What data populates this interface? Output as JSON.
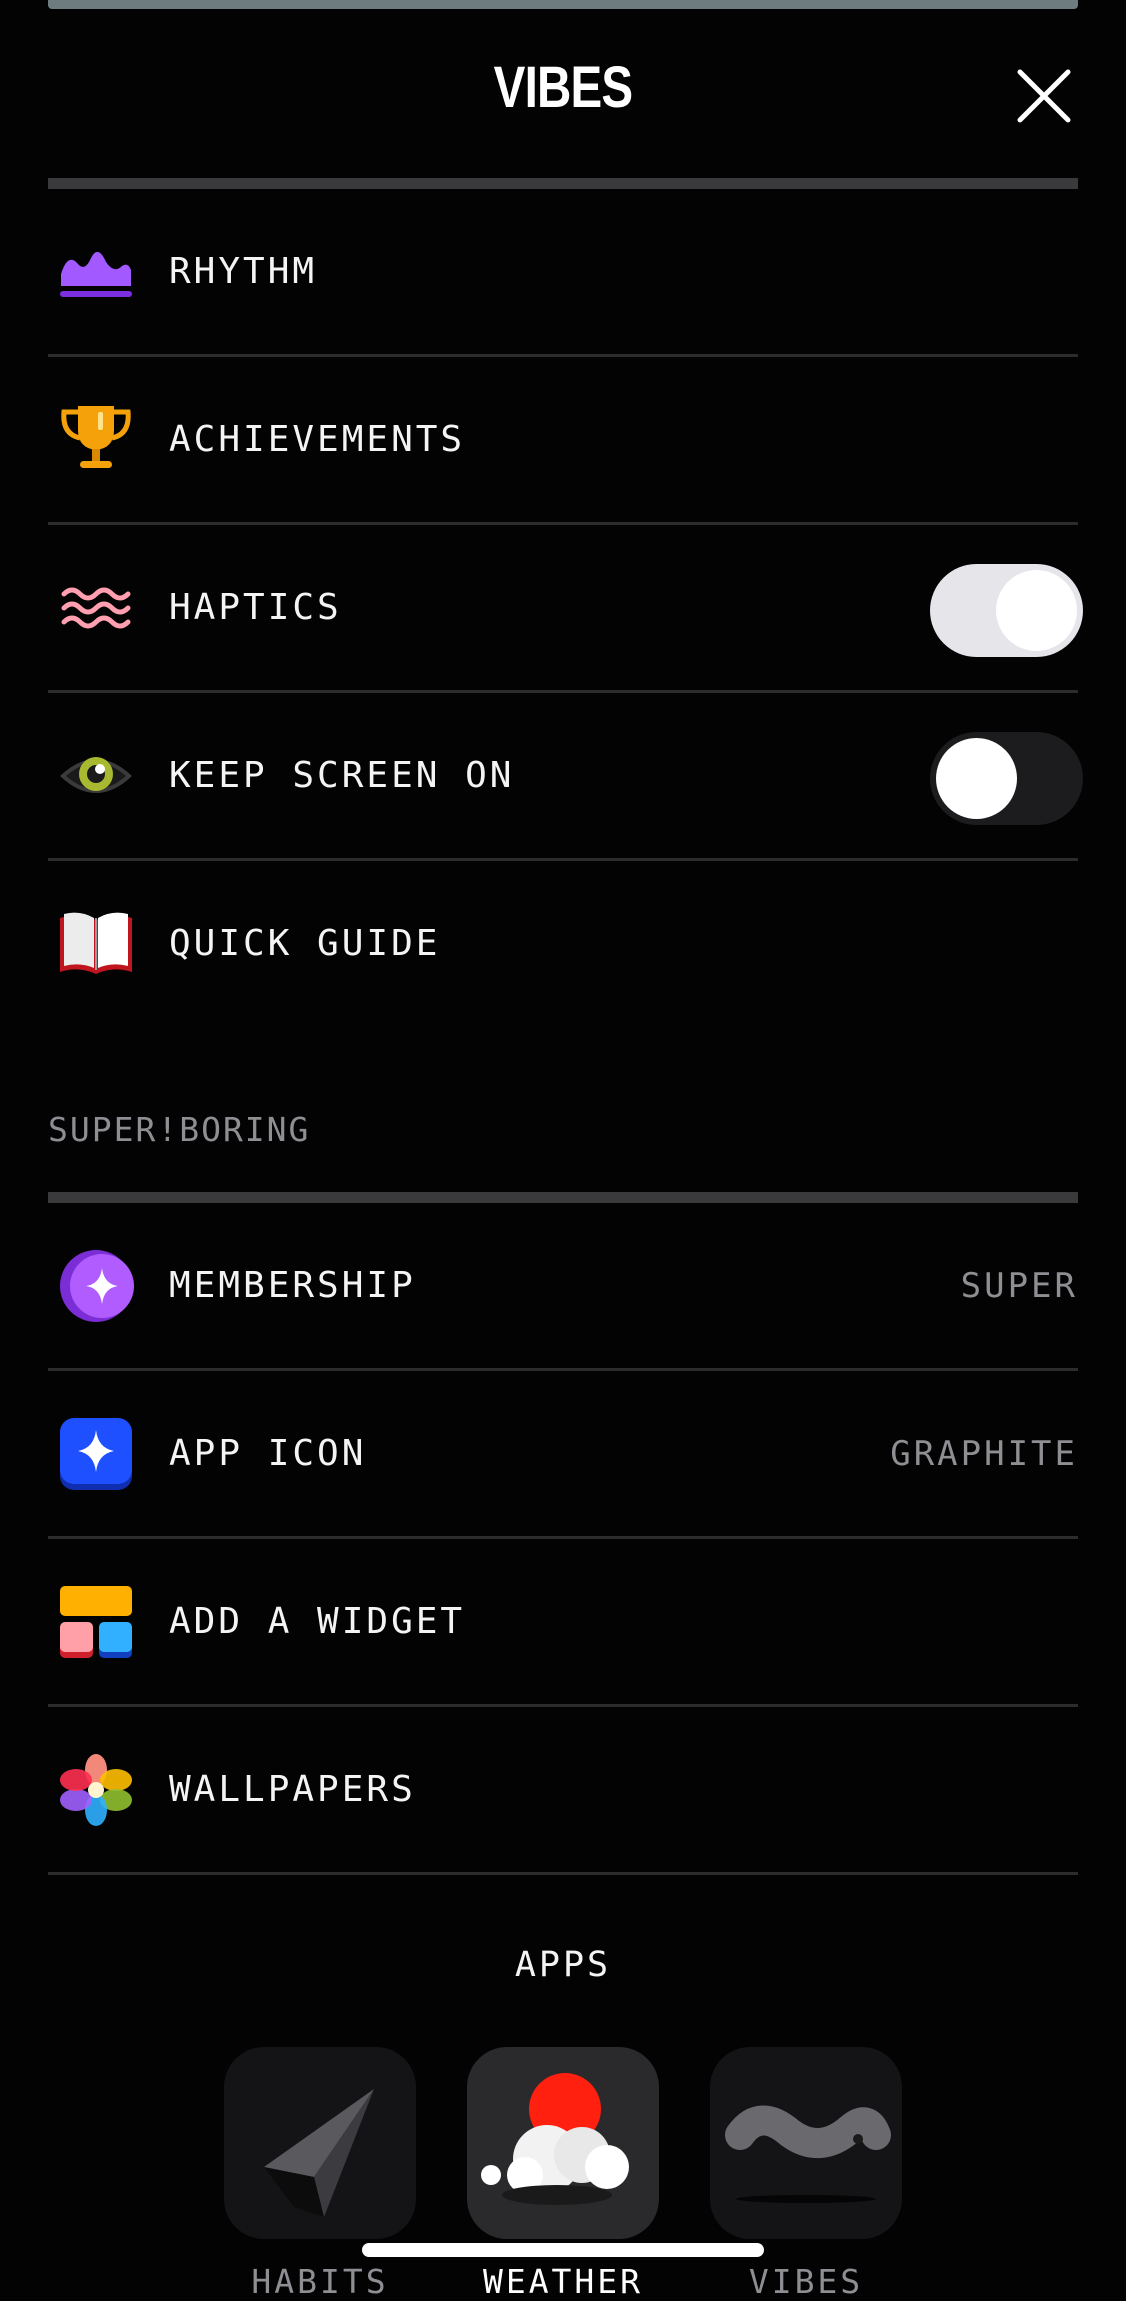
{
  "header": {
    "title": "VIBES"
  },
  "items": [
    {
      "label": "RHYTHM",
      "icon": "rhythm-wave-icon"
    },
    {
      "label": "ACHIEVEMENTS",
      "icon": "trophy-icon"
    },
    {
      "label": "HAPTICS",
      "icon": "haptic-waves-icon",
      "toggle": true
    },
    {
      "label": "KEEP SCREEN ON",
      "icon": "eye-icon",
      "toggle": false
    },
    {
      "label": "QUICK GUIDE",
      "icon": "open-book-icon"
    }
  ],
  "section": {
    "title": "SUPER!BORING"
  },
  "super_items": [
    {
      "label": "MEMBERSHIP",
      "value": "SUPER",
      "icon": "sparkle-moon-icon"
    },
    {
      "label": "APP ICON",
      "value": "GRAPHITE",
      "icon": "app-icon-sparkle-icon"
    },
    {
      "label": "ADD A WIDGET",
      "icon": "widget-blocks-icon"
    },
    {
      "label": "WALLPAPERS",
      "icon": "flower-icon"
    }
  ],
  "apps": {
    "title": "APPS",
    "list": [
      {
        "label": "HABITS",
        "icon": "paper-plane-icon"
      },
      {
        "label": "WEATHER",
        "icon": "cloud-sun-icon"
      },
      {
        "label": "VIBES",
        "icon": "squiggle-icon"
      }
    ]
  },
  "colors": {
    "background": "#030304",
    "divider": "#2c2c2e",
    "section_bar": "#3a3a3c",
    "secondary_text": "#8e8e93",
    "rhythm_purple": "#a259ff",
    "trophy_orange": "#f5a20a",
    "haptics_pink": "#ff9fb0",
    "eye_yellow": "#a8b830",
    "membership_purple": "#a64dff",
    "app_icon_blue": "#1e50ff"
  }
}
